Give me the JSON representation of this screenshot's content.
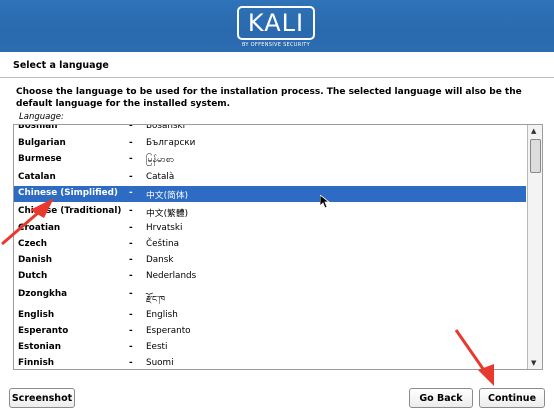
{
  "brand": {
    "logo_text": "KALI",
    "logo_subtitle": "BY OFFENSIVE SECURITY"
  },
  "page": {
    "heading": "Select a language",
    "description": "Choose the language to be used for the installation process. The selected language will also be the default language for the installed system.",
    "field_label": "Language:"
  },
  "languages": [
    {
      "name": "Bosnian",
      "separator": "-",
      "native": "Bosanski"
    },
    {
      "name": "Bulgarian",
      "separator": "-",
      "native": "Български"
    },
    {
      "name": "Burmese",
      "separator": "-",
      "native": "မြန်မာစာ"
    },
    {
      "name": "Catalan",
      "separator": "-",
      "native": "Català"
    },
    {
      "name": "Chinese (Simplified)",
      "separator": "-",
      "native": "中文(简体)"
    },
    {
      "name": "Chinese (Traditional)",
      "separator": "-",
      "native": "中文(繁體)"
    },
    {
      "name": "Croatian",
      "separator": "-",
      "native": "Hrvatski"
    },
    {
      "name": "Czech",
      "separator": "-",
      "native": "Čeština"
    },
    {
      "name": "Danish",
      "separator": "-",
      "native": "Dansk"
    },
    {
      "name": "Dutch",
      "separator": "-",
      "native": "Nederlands"
    },
    {
      "name": "Dzongkha",
      "separator": "-",
      "native": "རྫོང་ཁ"
    },
    {
      "name": "English",
      "separator": "-",
      "native": "English"
    },
    {
      "name": "Esperanto",
      "separator": "-",
      "native": "Esperanto"
    },
    {
      "name": "Estonian",
      "separator": "-",
      "native": "Eesti"
    },
    {
      "name": "Finnish",
      "separator": "-",
      "native": "Suomi"
    }
  ],
  "selected_language": "Chinese (Simplified)",
  "buttons": {
    "screenshot": "Screenshot",
    "go_back": "Go Back",
    "continue": "Continue"
  },
  "colors": {
    "banner": "#2d6db1",
    "selection": "#2e6cc4",
    "annotation_arrow": "#e8392f"
  },
  "scrollbar_position": 0.05
}
